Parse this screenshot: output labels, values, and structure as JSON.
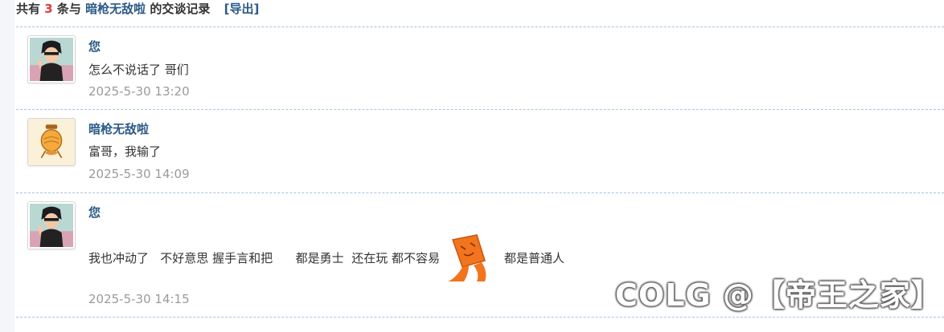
{
  "summary": {
    "prefix": "共有",
    "count": "3",
    "middle": "条与",
    "partner": "暗枪无敌啦",
    "suffix": "的交谈记录",
    "export": "[导出]"
  },
  "messages": [
    {
      "author": "您",
      "text": "怎么不说话了 哥们",
      "time": "2025-5-30 13:20",
      "avatar": "anime-character-avatar"
    },
    {
      "author": "暗枪无敌啦",
      "text": "富哥，我输了",
      "time": "2025-5-30 14:09",
      "avatar": "orange-lantern-avatar"
    },
    {
      "author": "您",
      "text_before": "我也冲动了   不好意思 握手言和把      都是勇士  还在玩 都不容易",
      "text_after": "都是普通人",
      "sticker": "orange-shy-sticker",
      "time": "2025-5-30 14:15",
      "avatar": "anime-character-avatar"
    }
  ],
  "watermark": "COLG @【帝王之家】",
  "colors": {
    "link": "#2b5a88",
    "count": "#e03a3a",
    "time": "#9a9a9a",
    "divider": "#a9c3d6"
  }
}
